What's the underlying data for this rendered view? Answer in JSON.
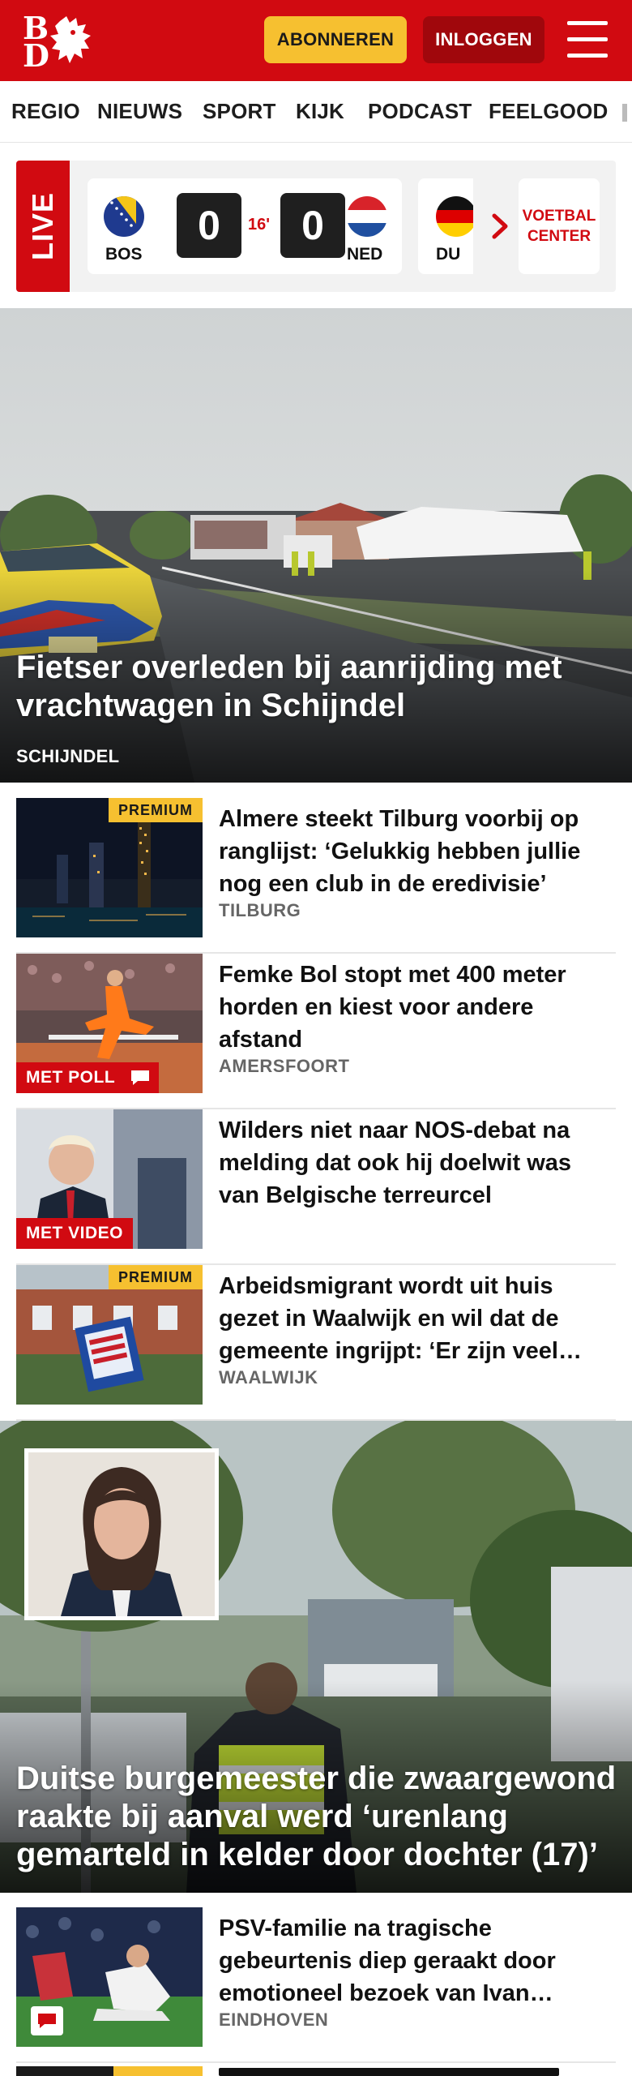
{
  "header": {
    "logo_letters": [
      "B",
      "D"
    ],
    "subscribe_label": "ABONNEREN",
    "login_label": "INLOGGEN"
  },
  "nav": {
    "items": [
      "REGIO",
      "NIEUWS",
      "SPORT",
      "KIJK",
      "PODCAST",
      "FEELGOOD"
    ]
  },
  "live": {
    "label": "LIVE",
    "match": {
      "home_code": "BOS",
      "home_score": "0",
      "minute": "16'",
      "away_score": "0",
      "away_code": "NED"
    },
    "next_match_code": "DU",
    "voetbal_line1": "VOETBAL",
    "voetbal_line2": "CENTER"
  },
  "hero": {
    "title": "Fietser overleden bij aanrijding met vrachtwagen in Schijndel",
    "location": "SCHIJNDEL"
  },
  "articles": [
    {
      "title": "Almere steekt Tilburg voorbij op ranglijst: ‘Gelukkig hebben jullie nog een club in de eredivisie’",
      "location": "TILBURG",
      "badge": "PREMIUM"
    },
    {
      "title": "Femke Bol stopt met 400 meter horden en kiest voor andere afstand",
      "location": "AMERSFOORT",
      "badge": "MET POLL"
    },
    {
      "title": "Wilders niet naar NOS-debat na melding dat ook hij doelwit was van Belgische terreurcel",
      "location": "",
      "badge": "MET VIDEO"
    },
    {
      "title": "Arbeidsmigrant wordt uit huis gezet in Waalwijk en wil dat de gemeente ingrijpt: ‘Er zijn veel…",
      "location": "WAALWIJK",
      "badge": "PREMIUM"
    }
  ],
  "feature": {
    "title": "Duitse burgemeester die zwaargewond raakte bij aanval werd ‘urenlang gemarteld in kelder door dochter (17)’"
  },
  "articles2": [
    {
      "title": "PSV-familie na tragische gebeurtenis diep geraakt door emotioneel bezoek van Ivan…",
      "location": "EINDHOVEN"
    }
  ],
  "colors": {
    "brand_red": "#d10a11",
    "premium_yellow": "#f6c030",
    "login_dark_red": "#a0070c"
  }
}
